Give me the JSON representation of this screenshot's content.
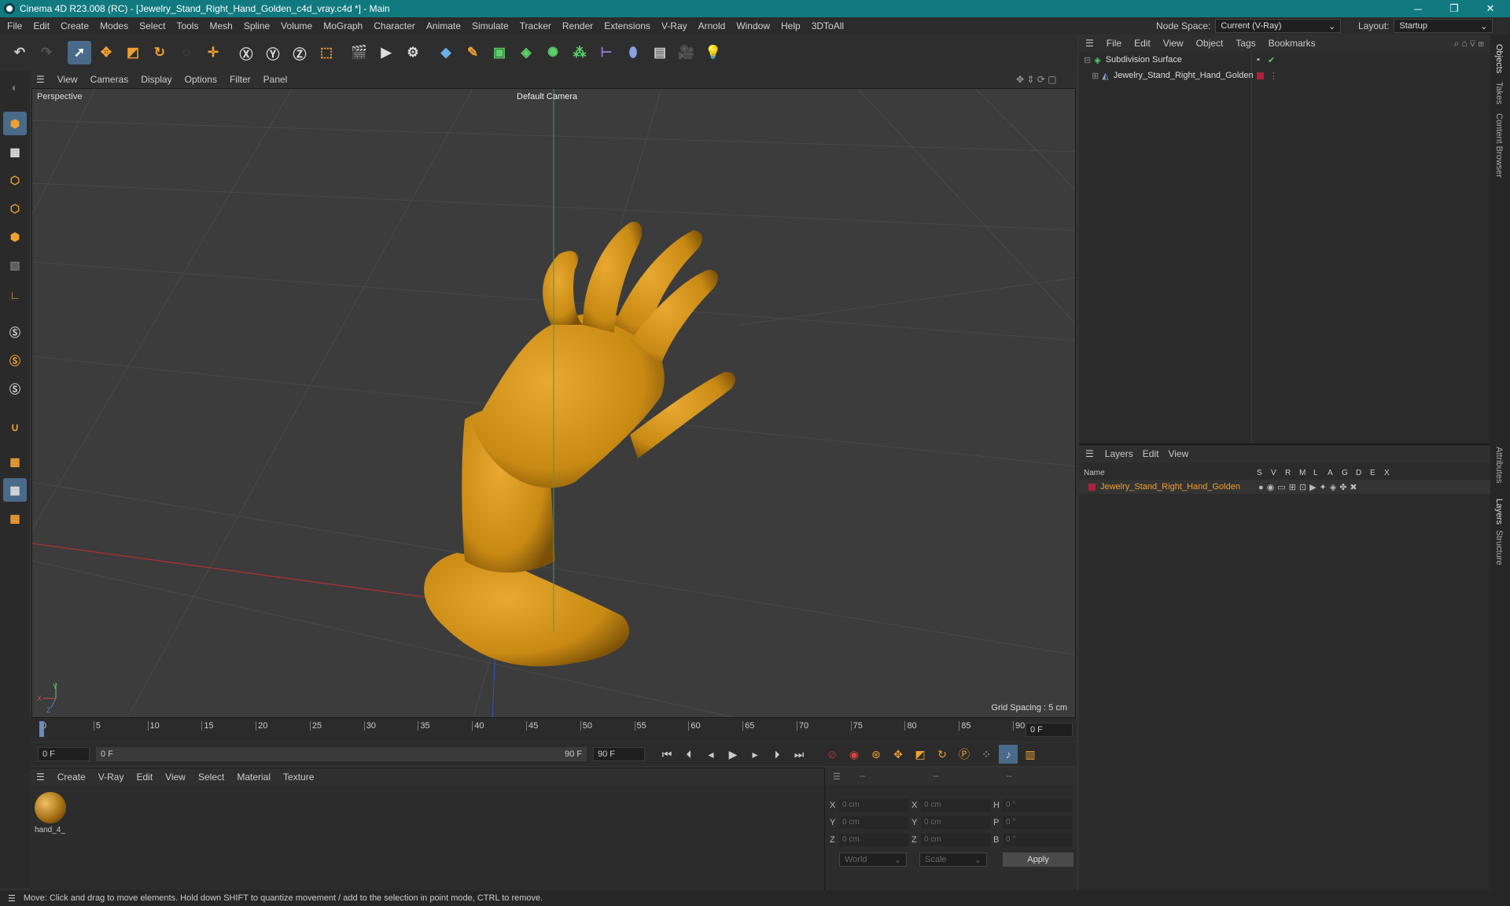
{
  "window": {
    "title": "Cinema 4D R23.008 (RC) - [Jewelry_Stand_Right_Hand_Golden_c4d_vray.c4d *] - Main",
    "minimize": "─",
    "restore": "❐",
    "close": "✕"
  },
  "menu": [
    "File",
    "Edit",
    "Create",
    "Modes",
    "Select",
    "Tools",
    "Mesh",
    "Spline",
    "Volume",
    "MoGraph",
    "Character",
    "Animate",
    "Simulate",
    "Tracker",
    "Render",
    "Extensions",
    "V-Ray",
    "Arnold",
    "Window",
    "Help",
    "3DToAll"
  ],
  "node_space": {
    "label": "Node Space:",
    "value": "Current (V-Ray)"
  },
  "layout": {
    "label": "Layout:",
    "value": "Startup"
  },
  "viewport_menu": [
    "View",
    "Cameras",
    "Display",
    "Options",
    "Filter",
    "Panel"
  ],
  "viewport": {
    "name": "Perspective",
    "camera": "Default Camera",
    "grid_spacing": "Grid Spacing : 5 cm",
    "axis_x": "X",
    "axis_y": "Y",
    "axis_z": "Z"
  },
  "timeline": {
    "ticks": [
      "0",
      "5",
      "10",
      "15",
      "20",
      "25",
      "30",
      "35",
      "40",
      "45",
      "50",
      "55",
      "60",
      "65",
      "70",
      "75",
      "80",
      "85",
      "90"
    ],
    "current_frame": "0 F"
  },
  "transport": {
    "start": "0 F",
    "range_start": "0 F",
    "range_end": "90 F",
    "end": "90 F"
  },
  "material_menu": [
    "Create",
    "V-Ray",
    "Edit",
    "View",
    "Select",
    "Material",
    "Texture"
  ],
  "material": {
    "name": "hand_4_"
  },
  "coords": {
    "header": [
      "--",
      "--",
      "--"
    ],
    "rows": [
      {
        "a": "X",
        "v1": "0 cm",
        "b": "X",
        "v2": "0 cm",
        "c": "H",
        "v3": "0 °"
      },
      {
        "a": "Y",
        "v1": "0 cm",
        "b": "Y",
        "v2": "0 cm",
        "c": "P",
        "v3": "0 °"
      },
      {
        "a": "Z",
        "v1": "0 cm",
        "b": "Z",
        "v2": "0 cm",
        "c": "B",
        "v3": "0 °"
      }
    ],
    "world": "World",
    "scale": "Scale",
    "apply": "Apply"
  },
  "objects_menu": [
    "File",
    "Edit",
    "View",
    "Object",
    "Tags",
    "Bookmarks"
  ],
  "objects": [
    {
      "name": "Subdivision Surface"
    },
    {
      "name": "Jewelry_Stand_Right_Hand_Golden"
    }
  ],
  "layers_menu": [
    "Layers",
    "Edit",
    "View"
  ],
  "layers": {
    "col_name": "Name",
    "cols": [
      "S",
      "V",
      "R",
      "M",
      "L",
      "A",
      "G",
      "D",
      "E",
      "X"
    ],
    "items": [
      {
        "name": "Jewelry_Stand_Right_Hand_Golden"
      }
    ]
  },
  "side_tabs": [
    "Objects",
    "Takes",
    "Content Browser",
    "Attributes",
    "Layers",
    "Structure"
  ],
  "status": "Move: Click and drag to move elements. Hold down SHIFT to quantize movement / add to the selection in point mode, CTRL to remove.",
  "colors": {
    "title_bg": "#117a80",
    "accent_orange": "#f0a030",
    "layer_red": "#b0203a",
    "hand_gold": "#d99a1c"
  }
}
